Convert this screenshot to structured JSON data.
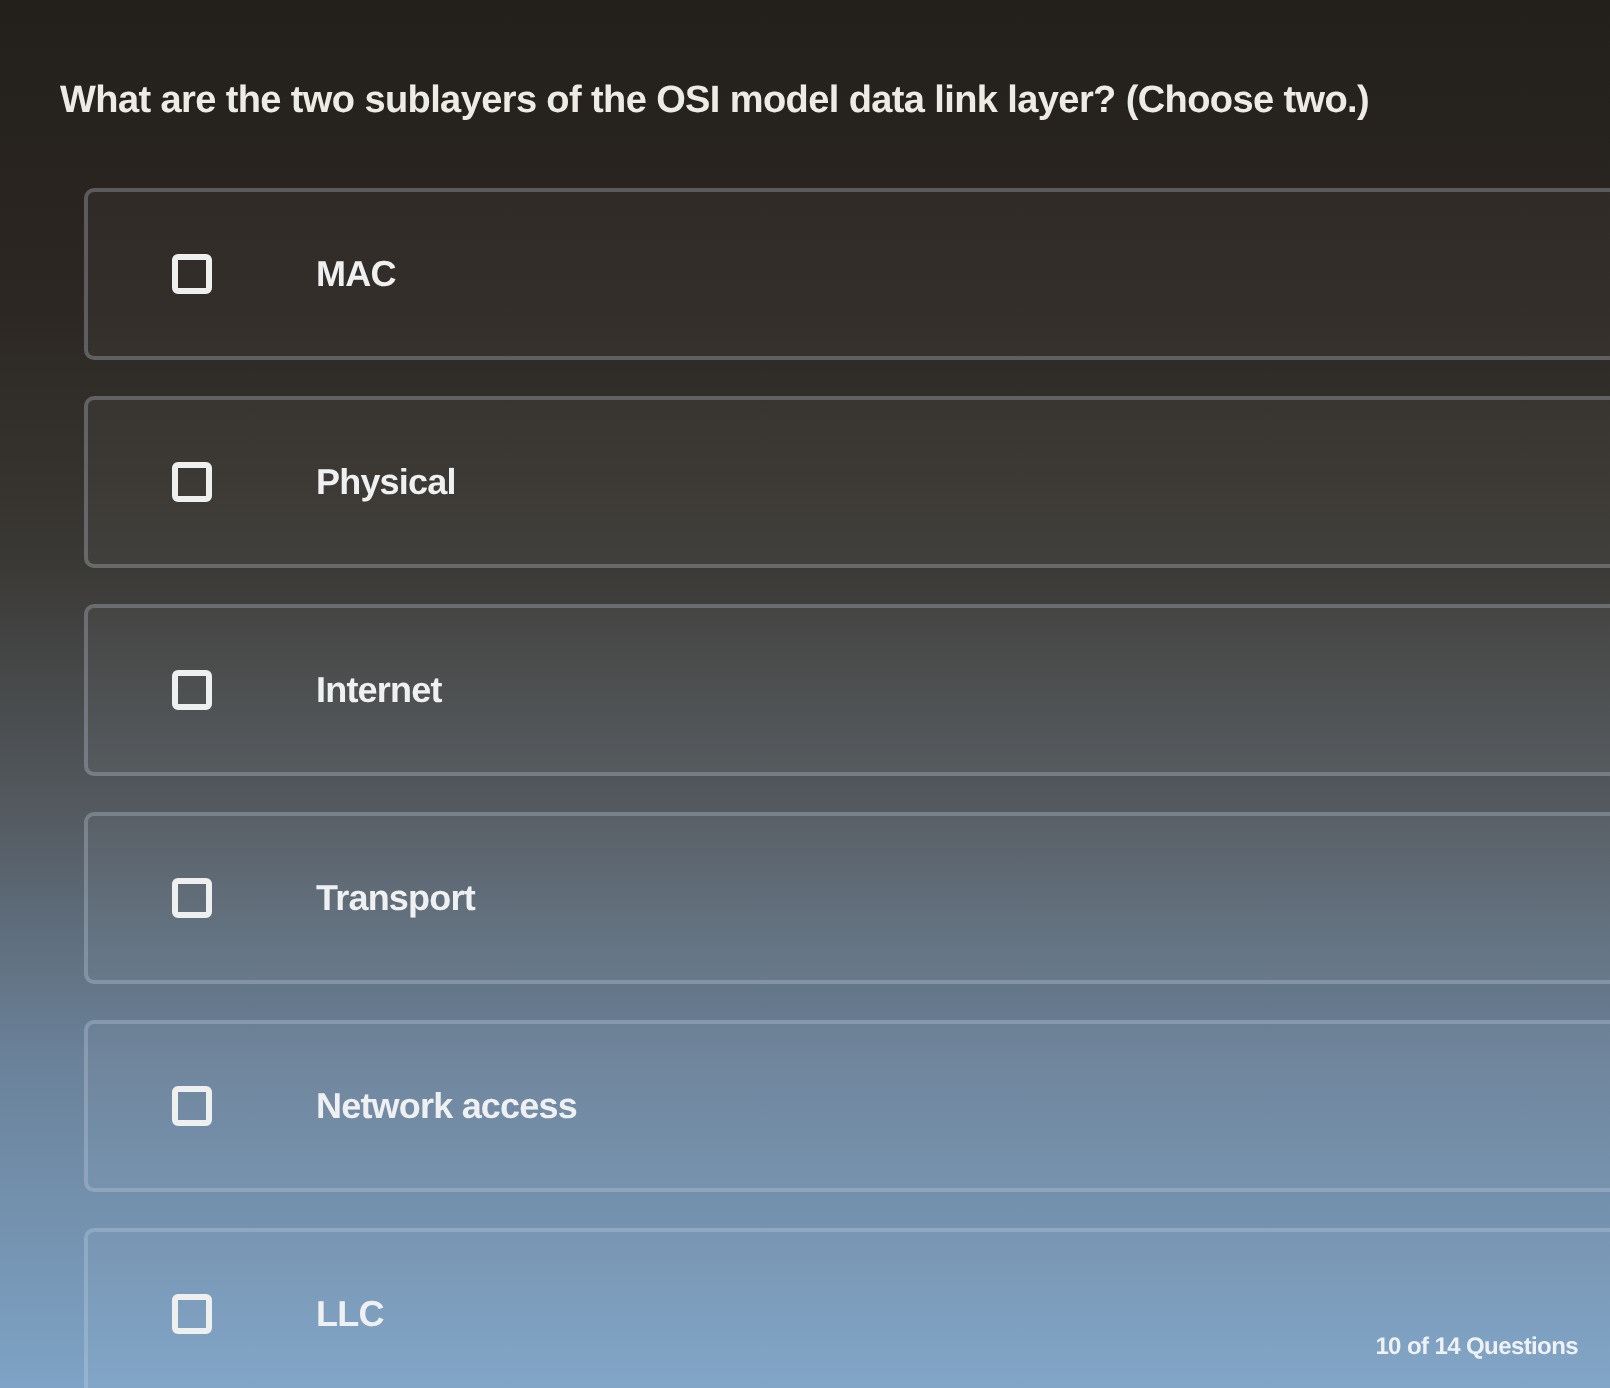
{
  "question": {
    "text": "What are the two sublayers of the OSI model data link layer? (Choose two.)"
  },
  "options": [
    {
      "label": "MAC",
      "checked": false
    },
    {
      "label": "Physical",
      "checked": false
    },
    {
      "label": "Internet",
      "checked": false
    },
    {
      "label": "Transport",
      "checked": false
    },
    {
      "label": "Network access",
      "checked": false
    },
    {
      "label": "LLC",
      "checked": false
    }
  ],
  "progress": {
    "text": "10 of 14 Questions"
  }
}
